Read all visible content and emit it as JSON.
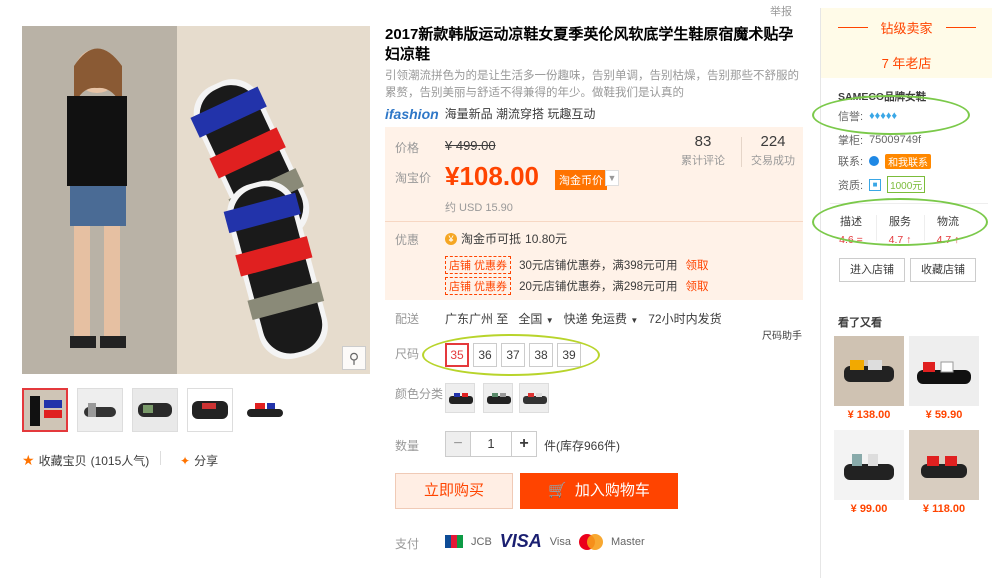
{
  "report": "举报",
  "gallery": {
    "zoom_icon": "magnifier-icon",
    "favorite": {
      "label": "收藏宝贝",
      "count": "(1015人气)",
      "icon": "star-icon"
    },
    "share": {
      "label": "分享",
      "icon": "share-icon"
    }
  },
  "product": {
    "title": "2017新款韩版运动凉鞋女夏季英伦风软底学生鞋原宿魔术贴孕妇凉鞋",
    "subtitle": "引领潮流拼色为的是让生活多一份趣味，告别单调，告别枯燥，告别那些不舒服的累赘，告别美丽与舒适不得兼得的年少。做鞋我们是认真的",
    "brand_logo": "ifashion",
    "brand_tagline": "海量新品 潮流穿搭 玩趣互动"
  },
  "price": {
    "orig_label": "价格",
    "orig_value": "¥ 499.00",
    "tb_label": "淘宝价",
    "current": "¥108.00",
    "coin_badge": "淘金币价",
    "usd": "约 USD 15.90",
    "reviews_count": "83",
    "reviews_label": "累计评论",
    "sales_count": "224",
    "sales_label": "交易成功"
  },
  "promo": {
    "label": "优惠",
    "coin_text": "淘金币可抵",
    "coin_amount": "10.80元",
    "coupons": [
      {
        "tag": "店铺 优惠券",
        "text": "30元店铺优惠券，满398元可用",
        "action": "领取"
      },
      {
        "tag": "店铺 优惠券",
        "text": "20元店铺优惠券，满298元可用",
        "action": "领取"
      }
    ]
  },
  "shipping": {
    "label": "配送",
    "from": "广东广州 至",
    "to": "全国",
    "method": "快递 免运费",
    "dispatch": "72小时内发货"
  },
  "size": {
    "label": "尺码",
    "helper": "尺码助手",
    "options": [
      "35",
      "36",
      "37",
      "38",
      "39"
    ],
    "selected": "35"
  },
  "color": {
    "label": "颜色分类"
  },
  "quantity": {
    "label": "数量",
    "value": "1",
    "stock": "件(库存966件)"
  },
  "actions": {
    "buy_now": "立即购买",
    "add_cart": "加入购物车"
  },
  "payment": {
    "label": "支付",
    "methods": [
      "JCB",
      "VISA",
      "Visa",
      "Master"
    ]
  },
  "seller": {
    "level": "钻级卖家",
    "years": "7 年老店",
    "shop_name": "SAMECO品牌女鞋",
    "credit_label": "信誉:",
    "credit_level": "5 diamonds",
    "keeper_label": "掌柜:",
    "keeper": "75009749f",
    "contact_label": "联系:",
    "contact_btn": "和我联系",
    "qual_label": "资质:",
    "deposit": "1000元",
    "dsr": [
      {
        "name": "描述",
        "score": "4.6 ="
      },
      {
        "name": "服务",
        "score": "4.7 ↑"
      },
      {
        "name": "物流",
        "score": "4.7 ↑"
      }
    ],
    "enter_shop": "进入店铺",
    "fav_shop": "收藏店铺"
  },
  "also_viewed": {
    "title": "看了又看",
    "items": [
      {
        "price": "¥ 138.00"
      },
      {
        "price": "¥ 59.90"
      },
      {
        "price": "¥ 99.00"
      },
      {
        "price": "¥ 118.00"
      }
    ]
  }
}
